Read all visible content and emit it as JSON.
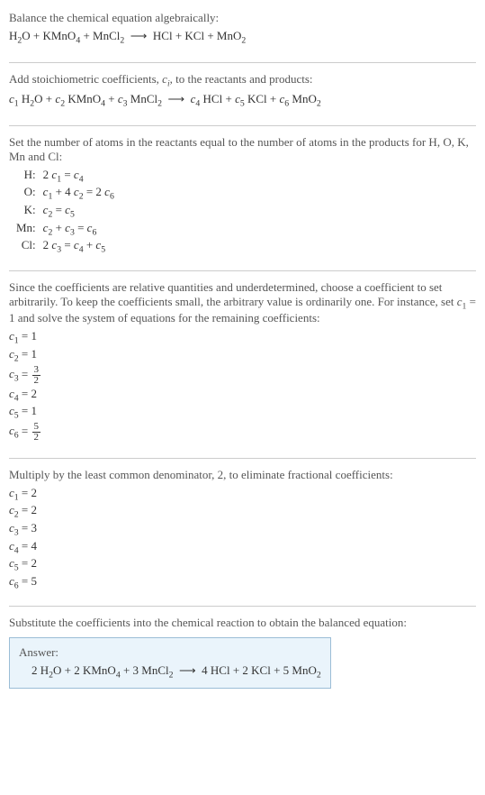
{
  "step1": {
    "instruction": "Balance the chemical equation algebraically:",
    "equation_html": "H<sub>2</sub>O + KMnO<sub>4</sub> + MnCl<sub>2</sub> &nbsp;⟶&nbsp; HCl + KCl + MnO<sub>2</sub>"
  },
  "step2": {
    "instruction_html": "Add stoichiometric coefficients, <span class='italic'>c<sub>i</sub></span>, to the reactants and products:",
    "equation_html": "<span class='italic'>c</span><sub>1</sub> H<sub>2</sub>O + <span class='italic'>c</span><sub>2</sub> KMnO<sub>4</sub> + <span class='italic'>c</span><sub>3</sub> MnCl<sub>2</sub> &nbsp;⟶&nbsp; <span class='italic'>c</span><sub>4</sub> HCl + <span class='italic'>c</span><sub>5</sub> KCl + <span class='italic'>c</span><sub>6</sub> MnO<sub>2</sub>"
  },
  "step3": {
    "instruction": "Set the number of atoms in the reactants equal to the number of atoms in the products for H, O, K, Mn and Cl:",
    "rows": [
      {
        "label": "H:",
        "eq_html": "2 <span class='italic'>c</span><sub>1</sub> = <span class='italic'>c</span><sub>4</sub>"
      },
      {
        "label": "O:",
        "eq_html": "<span class='italic'>c</span><sub>1</sub> + 4 <span class='italic'>c</span><sub>2</sub> = 2 <span class='italic'>c</span><sub>6</sub>"
      },
      {
        "label": "K:",
        "eq_html": "<span class='italic'>c</span><sub>2</sub> = <span class='italic'>c</span><sub>5</sub>"
      },
      {
        "label": "Mn:",
        "eq_html": "<span class='italic'>c</span><sub>2</sub> + <span class='italic'>c</span><sub>3</sub> = <span class='italic'>c</span><sub>6</sub>"
      },
      {
        "label": "Cl:",
        "eq_html": "2 <span class='italic'>c</span><sub>3</sub> = <span class='italic'>c</span><sub>4</sub> + <span class='italic'>c</span><sub>5</sub>"
      }
    ]
  },
  "step4": {
    "instruction_html": "Since the coefficients are relative quantities and underdetermined, choose a coefficient to set arbitrarily. To keep the coefficients small, the arbitrary value is ordinarily one. For instance, set <span class='italic'>c</span><sub>1</sub> = 1 and solve the system of equations for the remaining coefficients:",
    "coefs": [
      {
        "lhs_html": "<span class='italic'>c</span><sub>1</sub>",
        "rhs_html": "1"
      },
      {
        "lhs_html": "<span class='italic'>c</span><sub>2</sub>",
        "rhs_html": "1"
      },
      {
        "lhs_html": "<span class='italic'>c</span><sub>3</sub>",
        "rhs_html": "<span class='frac'><span class='num'>3</span><span class='den'>2</span></span>"
      },
      {
        "lhs_html": "<span class='italic'>c</span><sub>4</sub>",
        "rhs_html": "2"
      },
      {
        "lhs_html": "<span class='italic'>c</span><sub>5</sub>",
        "rhs_html": "1"
      },
      {
        "lhs_html": "<span class='italic'>c</span><sub>6</sub>",
        "rhs_html": "<span class='frac'><span class='num'>5</span><span class='den'>2</span></span>"
      }
    ]
  },
  "step5": {
    "instruction": "Multiply by the least common denominator, 2, to eliminate fractional coefficients:",
    "coefs": [
      {
        "lhs_html": "<span class='italic'>c</span><sub>1</sub>",
        "rhs": "2"
      },
      {
        "lhs_html": "<span class='italic'>c</span><sub>2</sub>",
        "rhs": "2"
      },
      {
        "lhs_html": "<span class='italic'>c</span><sub>3</sub>",
        "rhs": "3"
      },
      {
        "lhs_html": "<span class='italic'>c</span><sub>4</sub>",
        "rhs": "4"
      },
      {
        "lhs_html": "<span class='italic'>c</span><sub>5</sub>",
        "rhs": "2"
      },
      {
        "lhs_html": "<span class='italic'>c</span><sub>6</sub>",
        "rhs": "5"
      }
    ]
  },
  "step6": {
    "instruction": "Substitute the coefficients into the chemical reaction to obtain the balanced equation:"
  },
  "answer": {
    "label": "Answer:",
    "equation_html": "2 H<sub>2</sub>O + 2 KMnO<sub>4</sub> + 3 MnCl<sub>2</sub> &nbsp;⟶&nbsp; 4 HCl + 2 KCl + 5 MnO<sub>2</sub>"
  },
  "chart_data": {
    "type": "table",
    "title": "Balanced chemical equation coefficients",
    "species": [
      "H2O",
      "KMnO4",
      "MnCl2",
      "HCl",
      "KCl",
      "MnO2"
    ],
    "side": [
      "reactant",
      "reactant",
      "reactant",
      "product",
      "product",
      "product"
    ],
    "initial_coefficients": [
      1,
      1,
      1.5,
      2,
      1,
      2.5
    ],
    "balanced_coefficients": [
      2,
      2,
      3,
      4,
      2,
      5
    ],
    "atom_balance": {
      "H": "2 c1 = c4",
      "O": "c1 + 4 c2 = 2 c6",
      "K": "c2 = c5",
      "Mn": "c2 + c3 = c6",
      "Cl": "2 c3 = c4 + c5"
    }
  }
}
